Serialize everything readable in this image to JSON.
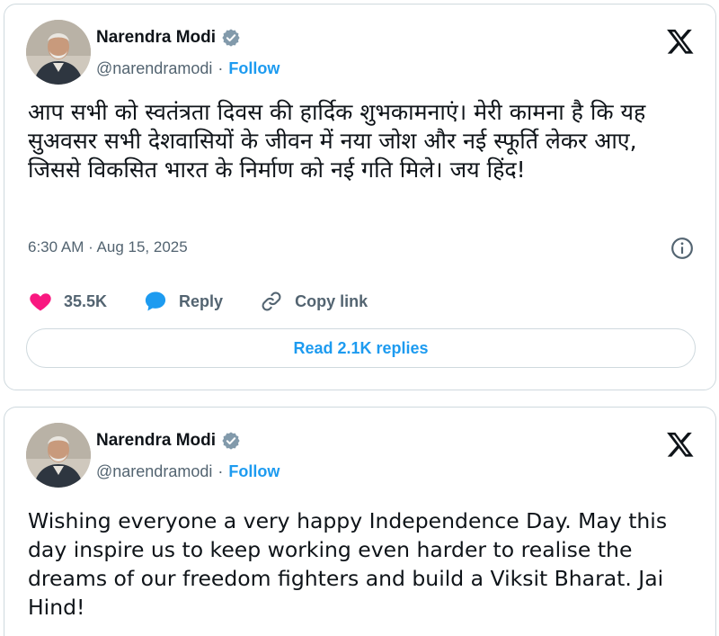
{
  "tweets": [
    {
      "author_name": "Narendra Modi",
      "handle": "@narendramodi",
      "separator": "·",
      "follow_label": "Follow",
      "text": "आप सभी को स्वतंत्रता दिवस की हार्दिक शुभकामनाएं। मेरी कामना है कि यह सुअवसर सभी देशवासियों के जीवन में नया जोश और नई स्फूर्ति लेकर आए, जिससे विकसित भारत के निर्माण को नई गति मिले। जय हिंद!",
      "timestamp": "6:30 AM · Aug 15, 2025",
      "likes": "35.5K",
      "reply_label": "Reply",
      "copy_link_label": "Copy link",
      "read_replies_label": "Read 2.1K replies"
    },
    {
      "author_name": "Narendra Modi",
      "handle": "@narendramodi",
      "separator": "·",
      "follow_label": "Follow",
      "text": "Wishing everyone a very happy Independence Day. May this day inspire us to keep working even harder to realise the dreams of our freedom fighters and build a Viksit Bharat. Jai Hind!"
    }
  ],
  "icons": {
    "verified": "verified-badge-icon",
    "platform": "x-logo-icon",
    "info": "info-icon",
    "like": "heart-icon",
    "reply": "speech-bubble-icon",
    "copy": "link-icon"
  },
  "colors": {
    "accent": "#1d9bf0",
    "like": "#f91880",
    "muted": "#536471",
    "text": "#0f1419",
    "border": "#cfd9de"
  }
}
